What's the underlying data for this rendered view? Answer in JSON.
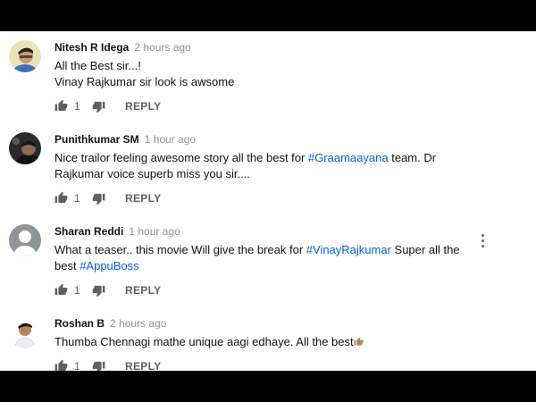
{
  "comments": [
    {
      "author": "Nitesh R Idega",
      "time": "2 hours ago",
      "lines": [
        "All the Best sir...!",
        "Vinay Rajkumar sir look is awsome"
      ],
      "likes": "1",
      "reply_label": "REPLY",
      "avatar_icon": "user-photo-avatar"
    },
    {
      "author": "Punithkumar SM",
      "time": "1 hour ago",
      "text_pre": "Nice trailor feeling awesome story all the best for ",
      "hashtag": "#Graamaayana",
      "text_post": " team. Dr Rajkumar voice superb miss you sir....",
      "likes": "1",
      "reply_label": "REPLY",
      "avatar_icon": "user-photo-avatar"
    },
    {
      "author": "Sharan Reddi",
      "time": "1 hour ago",
      "text_pre": "What a teaser.. this movie Will give the break for ",
      "hashtag1": "#VinayRajkumar",
      "text_mid": " Super all the best ",
      "hashtag2": "#AppuBoss",
      "likes": "1",
      "reply_label": "REPLY",
      "avatar_icon": "default-user-avatar"
    },
    {
      "author": "Roshan B",
      "time": "2 hours ago",
      "text": "Thumba Chennagi mathe unique aagi edhaye. All the best",
      "emoji_icon": "thumbs-up-emoji-icon",
      "likes": "1",
      "reply_label": "REPLY",
      "avatar_icon": "user-photo-avatar"
    }
  ],
  "colors": {
    "hashtag": "#065fd4",
    "meta": "#909090",
    "action": "#606060"
  }
}
